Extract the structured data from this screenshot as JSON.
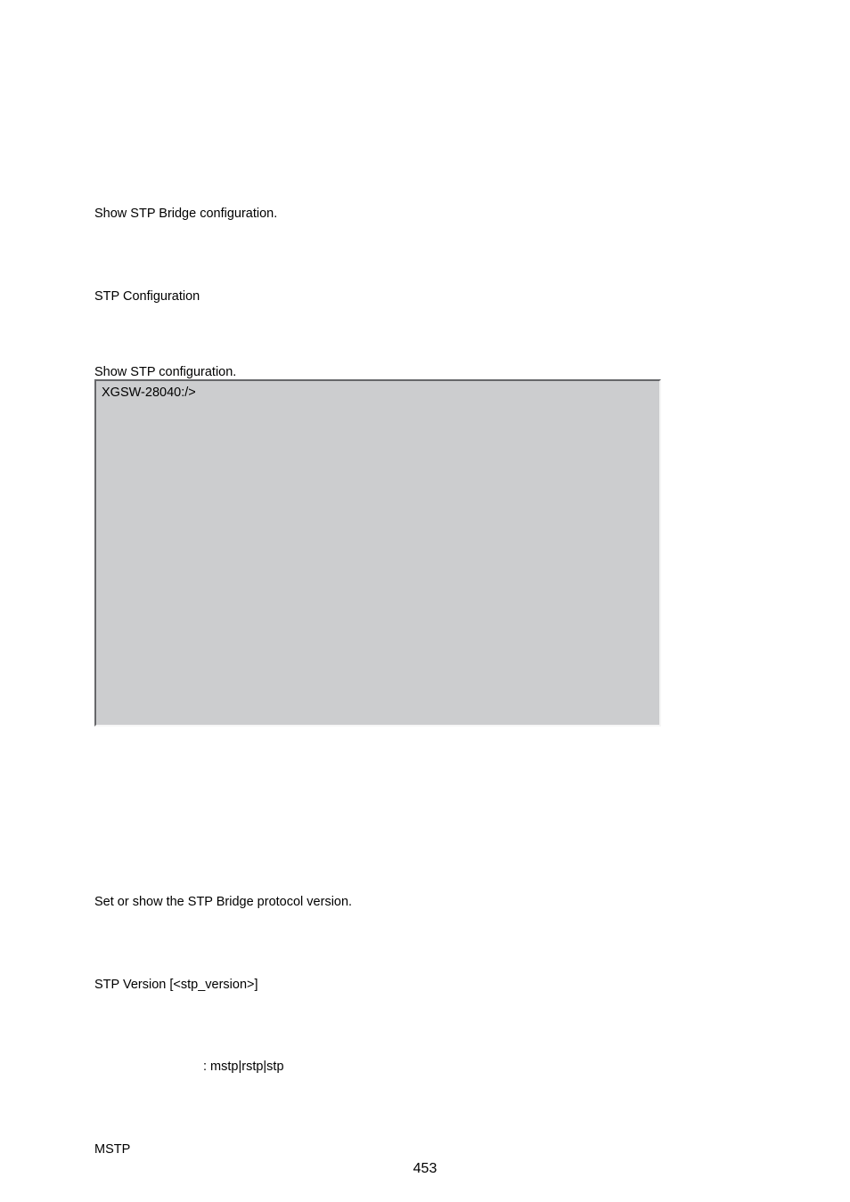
{
  "body": {
    "show_bridge": "Show STP Bridge configuration.",
    "stp_cfg": "STP Configuration",
    "show_cfg": "Show STP configuration.",
    "code_prompt": "XGSW-28040:/>",
    "set_show": "Set or show the STP Bridge protocol version.",
    "stp_version_syntax": "STP Version [<stp_version>]",
    "param_sep": ": mstp|rstp|stp",
    "mstp": "MSTP"
  },
  "page_number": "453"
}
